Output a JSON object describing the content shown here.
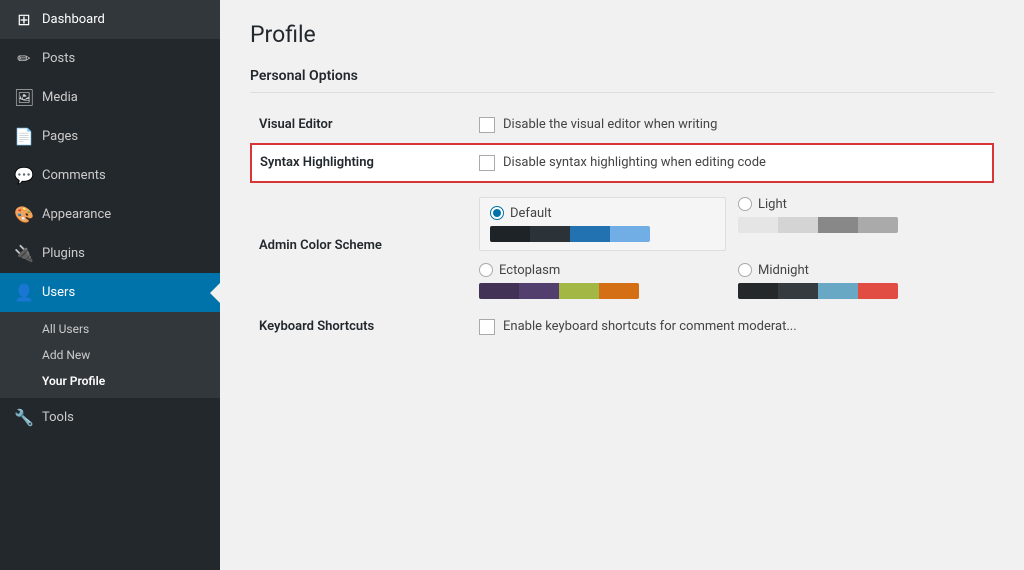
{
  "sidebar": {
    "items": [
      {
        "id": "dashboard",
        "label": "Dashboard",
        "icon": "⊞"
      },
      {
        "id": "posts",
        "label": "Posts",
        "icon": "✎"
      },
      {
        "id": "media",
        "label": "Media",
        "icon": "🖼"
      },
      {
        "id": "pages",
        "label": "Pages",
        "icon": "📄"
      },
      {
        "id": "comments",
        "label": "Comments",
        "icon": "💬"
      },
      {
        "id": "appearance",
        "label": "Appearance",
        "icon": "🎨"
      },
      {
        "id": "plugins",
        "label": "Plugins",
        "icon": "🔌"
      },
      {
        "id": "users",
        "label": "Users",
        "icon": "👤",
        "active": true
      },
      {
        "id": "tools",
        "label": "Tools",
        "icon": "🔧"
      }
    ],
    "users_submenu": [
      {
        "id": "all-users",
        "label": "All Users"
      },
      {
        "id": "add-new",
        "label": "Add New"
      },
      {
        "id": "your-profile",
        "label": "Your Profile",
        "active": true
      }
    ]
  },
  "main": {
    "page_title": "Profile",
    "section_title": "Personal Options",
    "rows": [
      {
        "id": "visual-editor",
        "label": "Visual Editor",
        "checkbox_label": "Disable the visual editor when writing",
        "checked": false,
        "highlighted": false
      },
      {
        "id": "syntax-highlighting",
        "label": "Syntax Highlighting",
        "checkbox_label": "Disable syntax highlighting when editing code",
        "checked": false,
        "highlighted": true
      }
    ],
    "color_scheme": {
      "label": "Admin Color Scheme",
      "options": [
        {
          "id": "default",
          "label": "Default",
          "selected": true,
          "swatches": [
            "#1d2327",
            "#2c3338",
            "#2271b1",
            "#72aee6"
          ]
        },
        {
          "id": "light",
          "label": "Light",
          "selected": false,
          "swatches": [
            "#e5e5e5",
            "#d4d4d4",
            "#888",
            "#aaa"
          ]
        },
        {
          "id": "ectoplasm",
          "label": "Ectoplasm",
          "selected": false,
          "swatches": [
            "#413256",
            "#523f6d",
            "#a3b745",
            "#d46f15"
          ]
        },
        {
          "id": "midnight",
          "label": "Midnight",
          "selected": false,
          "swatches": [
            "#25282b",
            "#363b3f",
            "#69a8c4",
            "#e14d43"
          ]
        }
      ]
    },
    "keyboard_shortcuts": {
      "label": "Keyboard Shortcuts",
      "checkbox_label": "Enable keyboard shortcuts for comment moderat..."
    }
  }
}
